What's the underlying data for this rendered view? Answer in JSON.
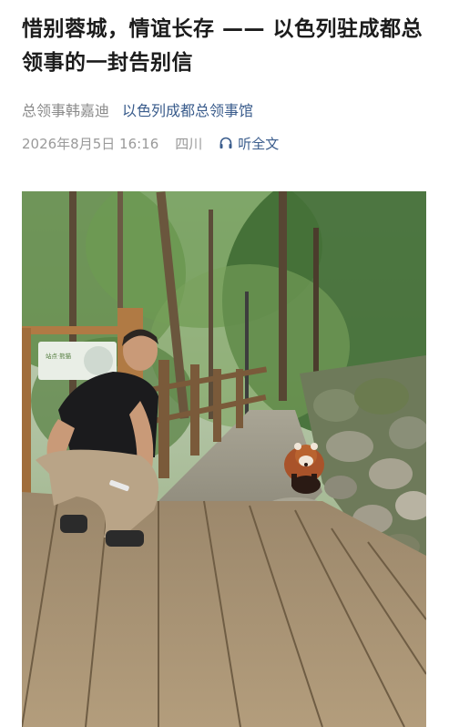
{
  "article": {
    "title": "惜别蓉城，情谊长存 —— 以色列驻成都总领事的一封告别信",
    "author": "总领事韩嘉迪",
    "publisher": "以色列成都总领事馆",
    "date": "2026年8月5日 16:16",
    "location": "四川",
    "listen_label": "听全文",
    "listen_icon": "headphones-icon"
  },
  "photo": {
    "sign_text": "站点·熊猫",
    "accent_green": "#4f7a3a",
    "wood_color": "#a88a62"
  }
}
